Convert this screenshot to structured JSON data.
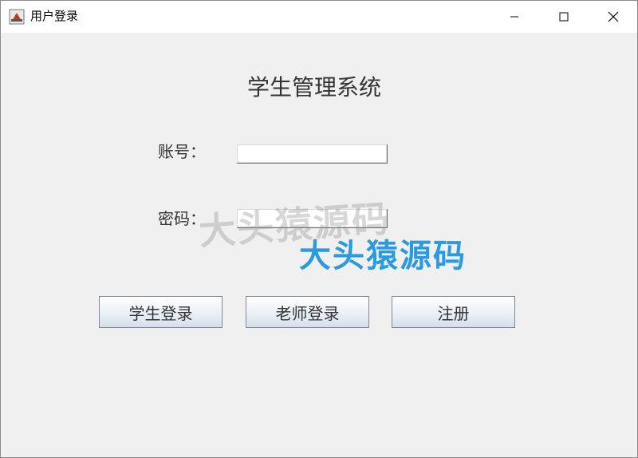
{
  "window": {
    "title": "用户登录",
    "minimize_glyph": "—",
    "maximize_glyph": "☐",
    "close_glyph": "✕"
  },
  "form": {
    "heading": "学生管理系统",
    "account_label": "账号：",
    "account_value": "",
    "password_label": "密码：",
    "password_value": ""
  },
  "buttons": {
    "student_login": "学生登录",
    "teacher_login": "老师登录",
    "register": "注册"
  },
  "watermark": {
    "text": "大头猿源码",
    "text_blue": "大头猿源码",
    "color": "#2b9be0"
  }
}
